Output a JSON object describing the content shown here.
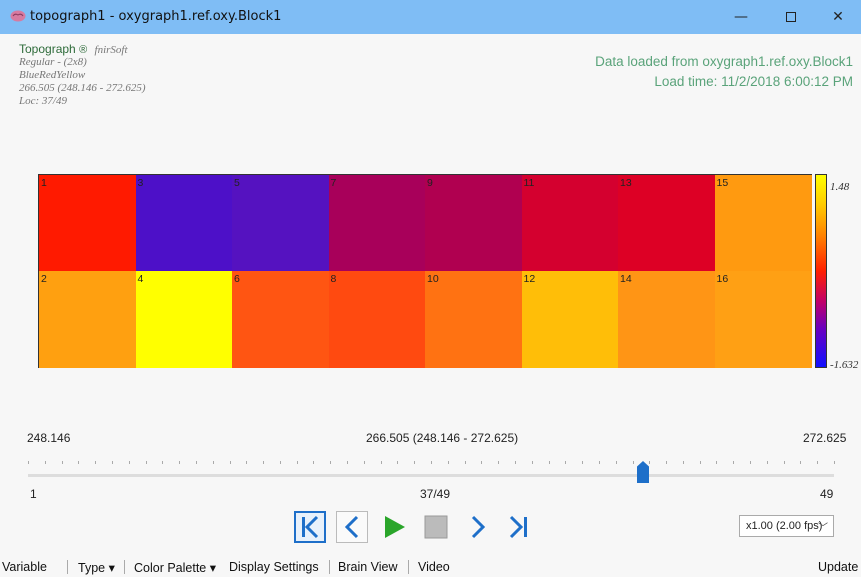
{
  "window": {
    "title": "topograph1 - oxygraph1.ref.oxy.Block1"
  },
  "info": {
    "brand": "Topograph",
    "reg": "®",
    "brand_sub": "fnirSoft",
    "lines": [
      "Regular - (2x8)",
      "BlueRedYellow",
      "266.505 (248.146 - 272.625)",
      "Loc: 37/49"
    ]
  },
  "load": {
    "line1": "Data loaded from oxygraph1.ref.oxy.Block1",
    "line2": "Load time: 11/2/2018 6:00:12 PM"
  },
  "heatmap": {
    "rows": [
      [
        {
          "label": "1",
          "color": "#ff1a00"
        },
        {
          "label": "3",
          "color": "#4d10c8"
        },
        {
          "label": "5",
          "color": "#5512c0"
        },
        {
          "label": "7",
          "color": "#a8005a"
        },
        {
          "label": "9",
          "color": "#b00050"
        },
        {
          "label": "11",
          "color": "#d4002f"
        },
        {
          "label": "13",
          "color": "#dd0025"
        },
        {
          "label": "15",
          "color": "#ff9a10"
        }
      ],
      [
        {
          "label": "2",
          "color": "#ffa010"
        },
        {
          "label": "4",
          "color": "#ffff00"
        },
        {
          "label": "6",
          "color": "#ff5512"
        },
        {
          "label": "8",
          "color": "#ff4a10"
        },
        {
          "label": "10",
          "color": "#ff7212"
        },
        {
          "label": "12",
          "color": "#ffbe08"
        },
        {
          "label": "14",
          "color": "#ff9515"
        },
        {
          "label": "16",
          "color": "#ffa014"
        }
      ]
    ]
  },
  "colorbar": {
    "max": "1.48",
    "min": "-1.632"
  },
  "timeline": {
    "min_label": "248.146",
    "center_label": "266.505 (248.146 - 272.625)",
    "max_label": "272.625",
    "frame_start": "1",
    "frame_current": "37/49",
    "frame_end": "49",
    "position": 0.75
  },
  "controls": {
    "fps": "x1.00 (2.00 fps)"
  },
  "menu": {
    "variable": "Variable",
    "type": "Type ▾",
    "palette": "Color Palette ▾",
    "display": "Display Settings",
    "brain": "Brain View",
    "video": "Video",
    "update": "Update"
  }
}
